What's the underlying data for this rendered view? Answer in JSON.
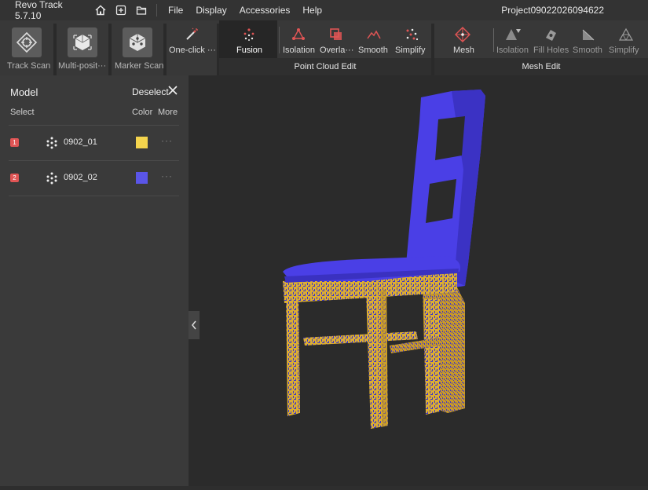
{
  "app": {
    "title": "Revo Track 5.7.10",
    "project": "Project09022026094622"
  },
  "menu": {
    "file": "File",
    "display": "Display",
    "accessories": "Accessories",
    "help": "Help"
  },
  "toolbar": {
    "track_scan": "Track Scan",
    "multi_position": "Multi-posit···",
    "marker_scan": "Marker Scan",
    "one_click": "One-click ···",
    "fusion": "Fusion",
    "pc_isolation": "Isolation",
    "pc_overlap": "Overla···",
    "pc_smooth": "Smooth",
    "pc_simplify": "Simplify",
    "mesh": "Mesh",
    "m_isolation": "Isolation",
    "m_fill_holes": "Fill Holes",
    "m_smooth": "Smooth",
    "m_simplify": "Simplify",
    "group_point_cloud": "Point Cloud Edit",
    "group_mesh": "Mesh Edit"
  },
  "panel": {
    "title": "Model",
    "deselect": "Deselect",
    "col_select": "Select",
    "col_color": "Color",
    "col_more": "More",
    "items": [
      {
        "index": "1",
        "name": "0902_01",
        "color": "#f4d44d"
      },
      {
        "index": "2",
        "name": "0902_02",
        "color": "#5a55e8"
      }
    ]
  },
  "colors": {
    "scan_blue": "#4a3fe6",
    "scan_yellow": "#e0b030",
    "accent_red": "#e05555"
  }
}
